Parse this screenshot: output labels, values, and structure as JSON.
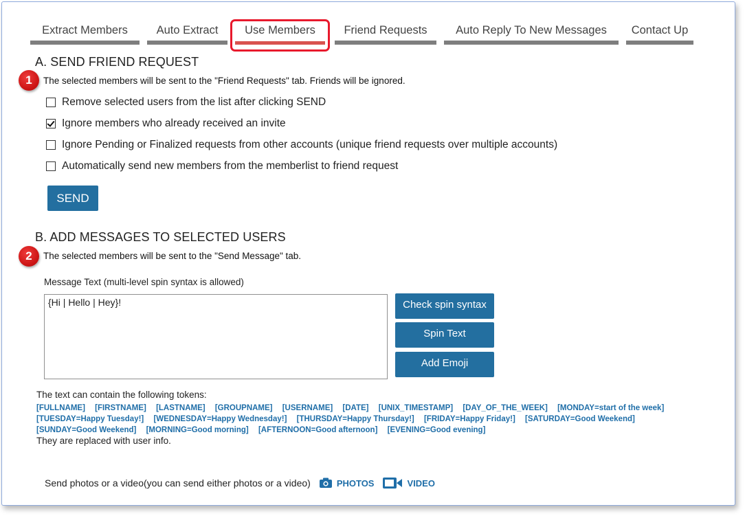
{
  "tabs": [
    {
      "label": "Extract Members"
    },
    {
      "label": "Auto Extract"
    },
    {
      "label": "Use Members"
    },
    {
      "label": "Friend Requests"
    },
    {
      "label": "Auto Reply To New Messages"
    },
    {
      "label": "Contact Up"
    }
  ],
  "active_tab": "Use Members",
  "section_a": {
    "title": "A. SEND FRIEND REQUEST",
    "badge": "1",
    "note": "The selected members will be sent to the \"Friend Requests\" tab. Friends will be ignored.",
    "options": [
      {
        "label": "Remove selected users from the list after clicking SEND",
        "checked": false
      },
      {
        "label": "Ignore members who already received an invite",
        "checked": true
      },
      {
        "label": "Ignore Pending or Finalized requests from other accounts (unique friend requests over multiple accounts)",
        "checked": false
      },
      {
        "label": "Automatically send new members from the memberlist to friend request",
        "checked": false
      }
    ],
    "send_label": "SEND"
  },
  "section_b": {
    "title": "B. ADD MESSAGES TO SELECTED USERS",
    "badge": "2",
    "note": "The selected members will be sent to the \"Send Message\" tab.",
    "message_label": "Message Text  (multi-level spin syntax is allowed)",
    "message_value": "{Hi | Hello | Hey}!",
    "check_spin_label": "Check spin syntax",
    "spin_text_label": "Spin Text",
    "add_emoji_label": "Add Emoji",
    "tokens_intro": "The text can contain the following tokens:",
    "tokens": [
      "[FULLNAME]",
      "[FIRSTNAME]",
      "[LASTNAME]",
      "[GROUPNAME]",
      "[USERNAME]",
      "[DATE]",
      "[UNIX_TIMESTAMP]",
      "[DAY_OF_THE_WEEK]",
      "[MONDAY=start of the week]",
      "[TUESDAY=Happy Tuesday!]",
      "[WEDNESDAY=Happy Wednesday!]",
      "[THURSDAY=Happy Thursday!]",
      "[FRIDAY=Happy Friday!]",
      "[SATURDAY=Good Weekend]",
      "[SUNDAY=Good Weekend]",
      "[MORNING=Good morning]",
      "[AFTERNOON=Good afternoon]",
      "[EVENING=Good evening]"
    ],
    "tokens_outro": "They are replaced with user info.",
    "media_text": "Send photos or a video(you can send either photos or a video)",
    "photos_label": "PHOTOS",
    "video_label": "VIDEO",
    "photos_icon": "camera-icon",
    "video_icon": "video-camera-icon"
  },
  "colors": {
    "accent": "#236fa0",
    "highlight": "#e8192c",
    "token": "#1f6ea8"
  }
}
